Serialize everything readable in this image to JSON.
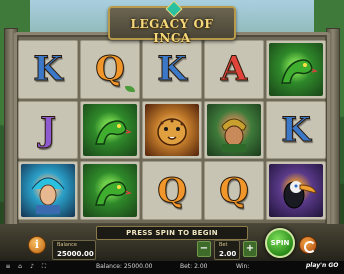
{
  "game": {
    "title": "LEGACY OF INCA"
  },
  "reels": [
    [
      "K",
      "Q",
      "K",
      "A",
      "snake"
    ],
    [
      "J",
      "snake",
      "jaguar",
      "warrior",
      "K"
    ],
    [
      "priestess",
      "snake",
      "Q",
      "Q",
      "toucan"
    ]
  ],
  "letter_colors": {
    "K": "#3c78c8",
    "Q": "#f0962a",
    "A": "#e0443a",
    "J": "#8e5ad0"
  },
  "hud": {
    "message": "PRESS SPIN TO BEGIN",
    "info_label": "i",
    "balance_label": "Balance",
    "balance_value": "25000.00",
    "bet_label": "Bet",
    "bet_value": "2.00",
    "minus_label": "−",
    "plus_label": "+",
    "spin_label": "SPIN"
  },
  "status_bar": {
    "balance_text": "Balance: 25000.00",
    "bet_text": "Bet: 2.00",
    "win_text": "Win:",
    "brand": "play'n GO"
  }
}
